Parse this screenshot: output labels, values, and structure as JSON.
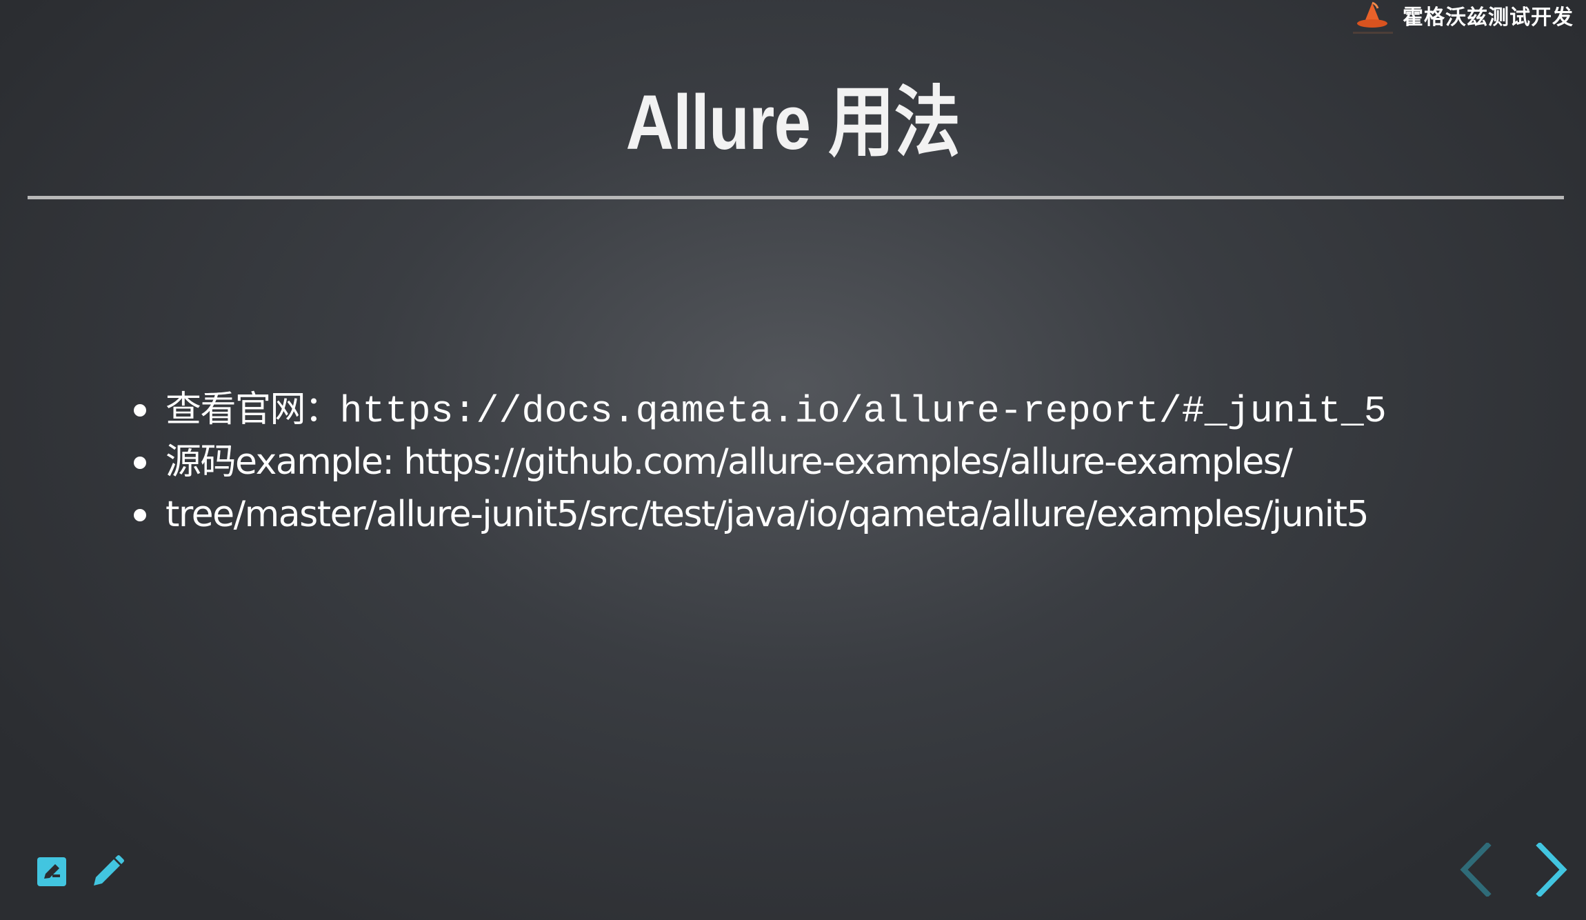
{
  "brand": {
    "name": "霍格沃兹测试开发",
    "logo_icon": "wizard-hat-logo-icon"
  },
  "slide": {
    "title": "Allure 用法",
    "items": [
      {
        "label": "查看官网：",
        "link": "https://docs.qameta.io/allure-report/#_junit_5"
      },
      {
        "label": "源码example: ",
        "link": "https://github.com/allure-examples/allure-examples/"
      },
      {
        "label": "",
        "link": "tree/master/allure-junit5/src/test/java/io/qameta/allure/examples/junit5"
      }
    ]
  },
  "toolbar": {
    "notes_icon": "edit-note-icon",
    "pen_icon": "pencil-icon"
  },
  "navigation": {
    "prev_icon": "chevron-left-icon",
    "next_icon": "chevron-right-icon"
  },
  "colors": {
    "accent": "#42c5e0",
    "accent_dim": "#2f6b78",
    "text": "#ffffff",
    "rule": "#b8b8b8"
  }
}
